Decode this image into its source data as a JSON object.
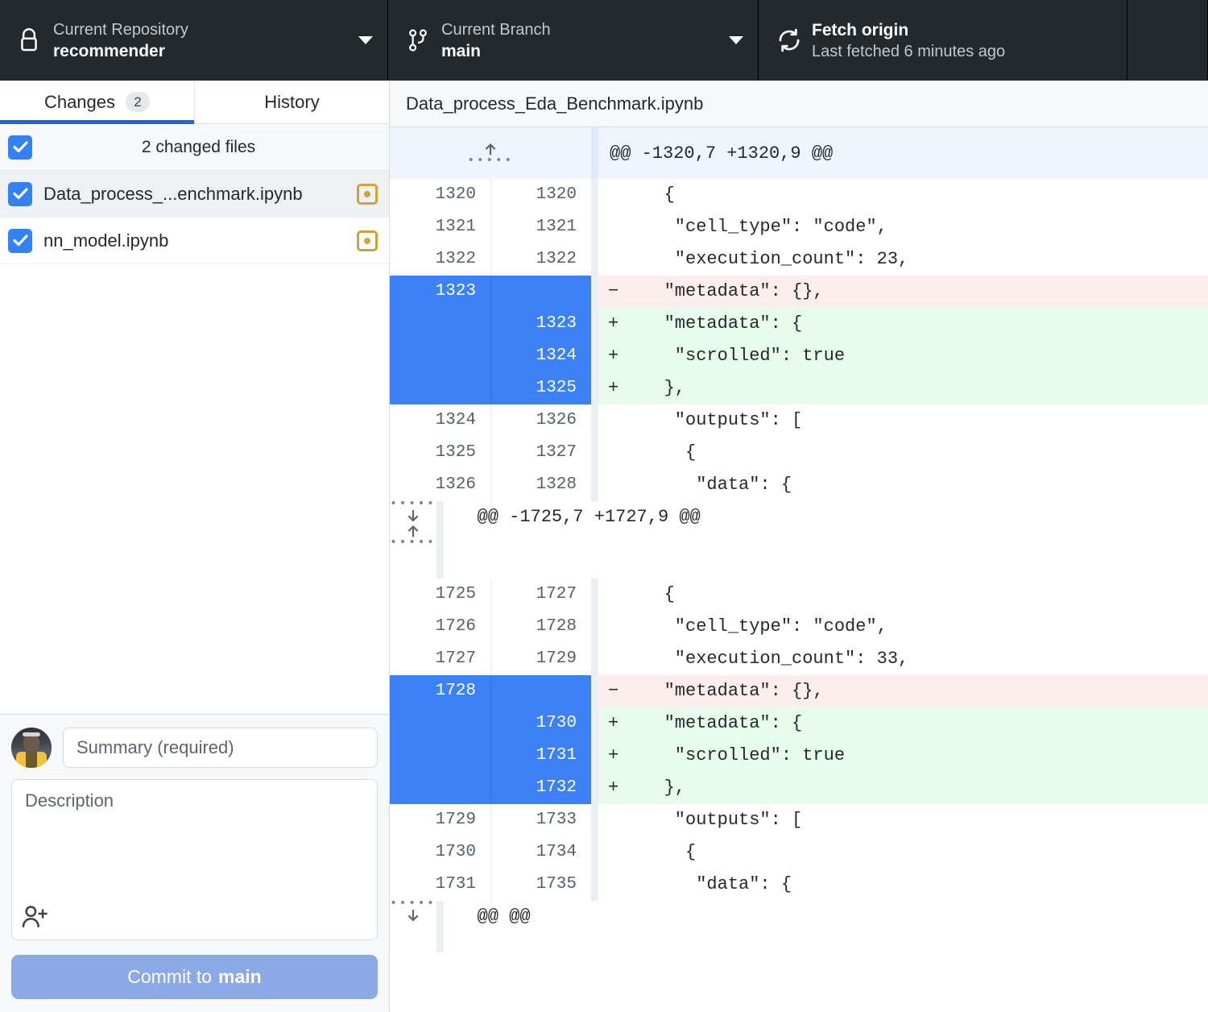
{
  "toolbar": {
    "repository": {
      "label": "Current Repository",
      "value": "recommender",
      "icon": "lock-icon"
    },
    "branch": {
      "label": "Current Branch",
      "value": "main",
      "icon": "git-branch-icon"
    },
    "fetch": {
      "title": "Fetch origin",
      "subtitle": "Last fetched 6 minutes ago",
      "icon": "sync-icon"
    }
  },
  "sidebar": {
    "tabs": [
      {
        "label": "Changes",
        "badge": "2",
        "active": true
      },
      {
        "label": "History",
        "badge": "",
        "active": false
      }
    ],
    "files_header": "2 changed files",
    "files": [
      {
        "name": "Data_process_...enchmark.ipynb",
        "status": "modified",
        "checked": true,
        "selected": true
      },
      {
        "name": "nn_model.ipynb",
        "status": "modified",
        "checked": true,
        "selected": false
      }
    ],
    "commit": {
      "summary_placeholder": "Summary (required)",
      "summary_value": "",
      "description_placeholder": "Description",
      "description_value": "",
      "add_coauthor_icon": "add-person-icon",
      "button_prefix": "Commit to",
      "button_branch": "main"
    }
  },
  "diff": {
    "file_title": "Data_process_Eda_Benchmark.ipynb",
    "rows": [
      {
        "type": "hunk",
        "expand": "up",
        "old": "",
        "new": "",
        "marker": "",
        "code": "@@ -1320,7 +1320,9 @@"
      },
      {
        "type": "ctx",
        "old": "1320",
        "new": "1320",
        "marker": "",
        "code": "   {"
      },
      {
        "type": "ctx",
        "old": "1321",
        "new": "1321",
        "marker": "",
        "code": "    \"cell_type\": \"code\","
      },
      {
        "type": "ctx",
        "old": "1322",
        "new": "1322",
        "marker": "",
        "code": "    \"execution_count\": 23,"
      },
      {
        "type": "del",
        "old": "1323",
        "new": "",
        "marker": "−",
        "code": "   \"metadata\": {},"
      },
      {
        "type": "add",
        "old": "",
        "new": "1323",
        "marker": "+",
        "code": "   \"metadata\": {"
      },
      {
        "type": "add",
        "old": "",
        "new": "1324",
        "marker": "+",
        "code": "    \"scrolled\": true"
      },
      {
        "type": "add",
        "old": "",
        "new": "1325",
        "marker": "+",
        "code": "   },"
      },
      {
        "type": "ctx",
        "old": "1324",
        "new": "1326",
        "marker": "",
        "code": "    \"outputs\": ["
      },
      {
        "type": "ctx",
        "old": "1325",
        "new": "1327",
        "marker": "",
        "code": "     {"
      },
      {
        "type": "ctx",
        "old": "1326",
        "new": "1328",
        "marker": "",
        "code": "      \"data\": {"
      },
      {
        "type": "hunk-mid",
        "expand": "both",
        "old": "",
        "new": "",
        "marker": "",
        "code": "@@ -1725,7 +1727,9 @@"
      },
      {
        "type": "ctx",
        "old": "1725",
        "new": "1727",
        "marker": "",
        "code": "   {"
      },
      {
        "type": "ctx",
        "old": "1726",
        "new": "1728",
        "marker": "",
        "code": "    \"cell_type\": \"code\","
      },
      {
        "type": "ctx",
        "old": "1727",
        "new": "1729",
        "marker": "",
        "code": "    \"execution_count\": 33,"
      },
      {
        "type": "del",
        "old": "1728",
        "new": "",
        "marker": "−",
        "code": "   \"metadata\": {},"
      },
      {
        "type": "add",
        "old": "",
        "new": "1730",
        "marker": "+",
        "code": "   \"metadata\": {"
      },
      {
        "type": "add",
        "old": "",
        "new": "1731",
        "marker": "+",
        "code": "    \"scrolled\": true"
      },
      {
        "type": "add",
        "old": "",
        "new": "1732",
        "marker": "+",
        "code": "   },"
      },
      {
        "type": "ctx",
        "old": "1729",
        "new": "1733",
        "marker": "",
        "code": "    \"outputs\": ["
      },
      {
        "type": "ctx",
        "old": "1730",
        "new": "1734",
        "marker": "",
        "code": "     {"
      },
      {
        "type": "ctx",
        "old": "1731",
        "new": "1735",
        "marker": "",
        "code": "      \"data\": {"
      },
      {
        "type": "hunk-end",
        "expand": "down",
        "old": "",
        "new": "",
        "marker": "",
        "code": "@@ @@"
      }
    ]
  },
  "colors": {
    "toolbar_bg": "#24292e",
    "accent_blue": "#2563d8",
    "checkbox_blue": "#3481f6",
    "selected_gutter": "#3c82f6",
    "modified_status": "#d1a336",
    "added_bg": "#e8fced",
    "deleted_bg": "#fdeeee",
    "hunk_bg": "#f0f5fd",
    "commit_button": "#8aa9e6"
  }
}
